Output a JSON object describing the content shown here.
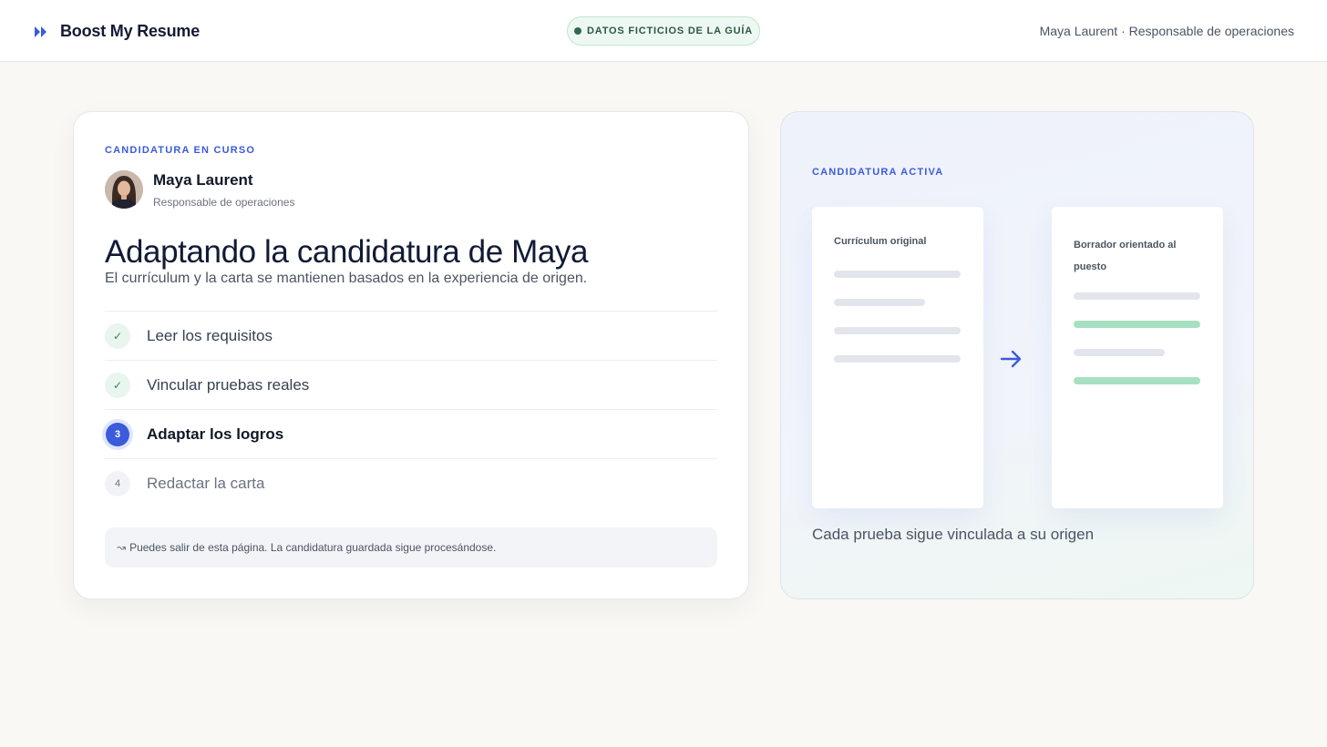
{
  "header": {
    "brand_icon": "double-chevron-right-icon",
    "brand_name": "Boost My Resume",
    "badge": "DATOS FICTICIOS DE LA GUÍA",
    "user_meta": "Maya Laurent · Responsable de operaciones"
  },
  "progress_card": {
    "eyebrow": "CANDIDATURA EN CURSO",
    "person": {
      "name": "Maya Laurent",
      "role": "Responsable de operaciones"
    },
    "title": "Adaptando la candidatura de Maya",
    "subtitle": "El currículum y la carta se mantienen basados en la experiencia de origen.",
    "steps": [
      {
        "mark": "✓",
        "label": "Leer los requisitos",
        "state": "done"
      },
      {
        "mark": "✓",
        "label": "Vincular pruebas reales",
        "state": "done"
      },
      {
        "mark": "3",
        "label": "Adaptar los logros",
        "state": "active"
      },
      {
        "mark": "4",
        "label": "Redactar la carta",
        "state": "todo"
      }
    ],
    "notice": {
      "icon": "↝",
      "text": "Puedes salir de esta página. La candidatura guardada sigue procesándose."
    }
  },
  "preview_card": {
    "eyebrow": "CANDIDATURA ACTIVA",
    "original_title": "Currículum original",
    "draft_title": "Borrador orientado al puesto",
    "arrow_icon": "arrow-right-icon",
    "caption": "Cada prueba sigue vinculada a su origen"
  },
  "colors": {
    "accent": "#3b5bdb",
    "success_bg": "#eef8f2",
    "highlight_bar": "#a7e0c1",
    "page_bg": "#faf8f4"
  }
}
